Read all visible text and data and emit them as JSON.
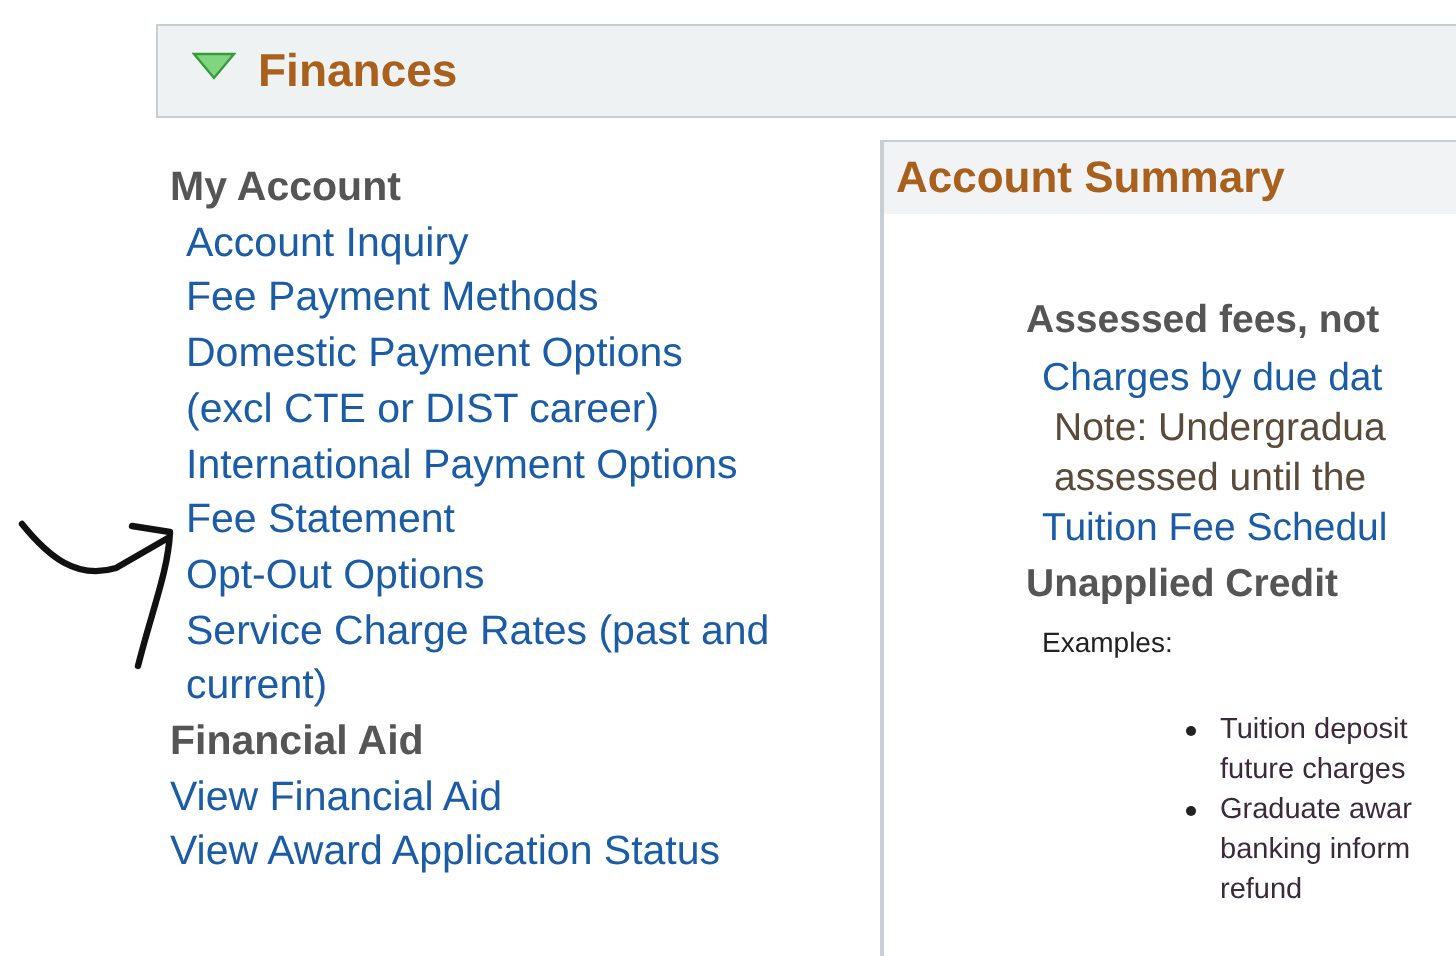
{
  "section": {
    "title": "Finances",
    "expanded": true
  },
  "nav": [
    {
      "heading": "My Account",
      "links": [
        "Account Inquiry",
        "Fee Payment Methods",
        "Domestic Payment Options (excl CTE or DIST career)",
        "International Payment Options",
        "Fee Statement",
        "Opt-Out Options",
        "Service Charge Rates (past and current)"
      ]
    },
    {
      "heading": "Financial Aid",
      "links": [
        "View Financial Aid",
        "View Award Application Status"
      ]
    }
  ],
  "summary": {
    "title": "Account Summary",
    "blocks": [
      {
        "kind": "heading",
        "text": "Assessed fees, not"
      },
      {
        "kind": "link",
        "text": "Charges by due dat"
      },
      {
        "kind": "note",
        "lines": [
          "Note: Undergradua",
          "assessed until the"
        ]
      },
      {
        "kind": "link",
        "text": "Tuition Fee Schedul"
      },
      {
        "kind": "heading",
        "text": "Unapplied Credit"
      },
      {
        "kind": "label",
        "text": "Examples:"
      },
      {
        "kind": "bullets",
        "items": [
          {
            "lines": [
              "Tuition deposit",
              "future charges"
            ]
          },
          {
            "lines": [
              "Graduate awar",
              "banking inform",
              "refund"
            ]
          }
        ]
      }
    ]
  }
}
